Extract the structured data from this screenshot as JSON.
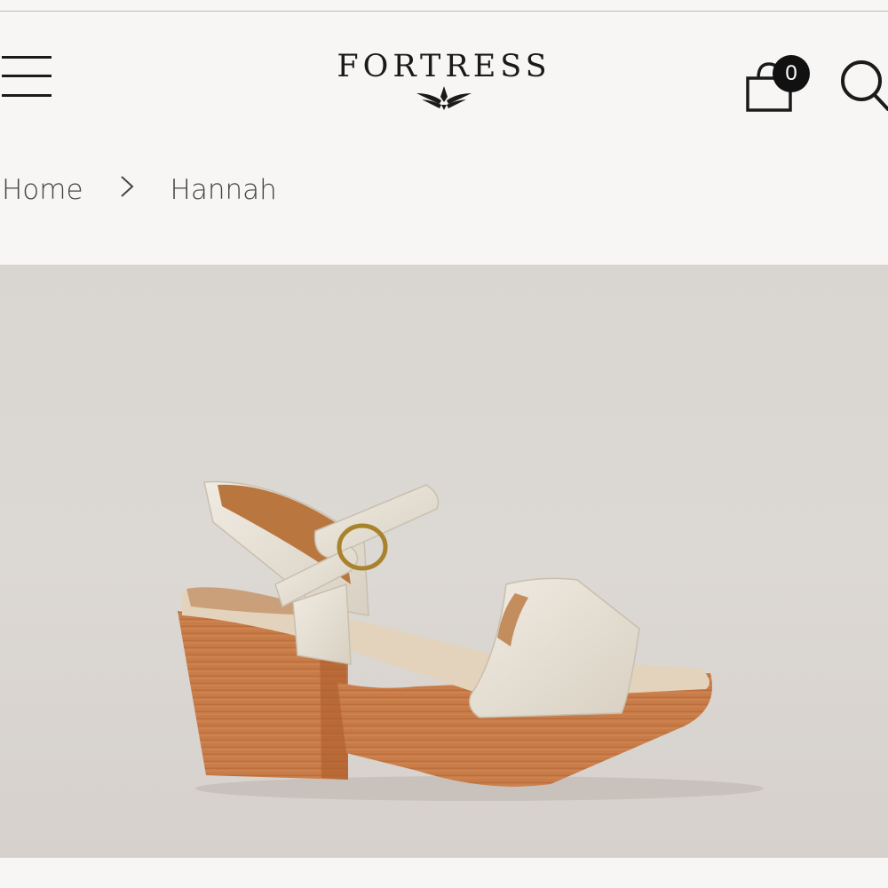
{
  "header": {
    "brand_name": "FORTRESS",
    "cart_count": "0"
  },
  "breadcrumb": {
    "home_label": "Home",
    "separator": ">",
    "current_label": "Hannah"
  },
  "icons": {
    "menu": "hamburger-menu-icon",
    "cart": "shopping-bag-icon",
    "search": "search-icon",
    "logo_mark": "wings-emblem-icon"
  },
  "colors": {
    "background": "#f8f6f4",
    "photo_background": "#d9d5d1",
    "text": "#222222",
    "badge": "#111111"
  }
}
